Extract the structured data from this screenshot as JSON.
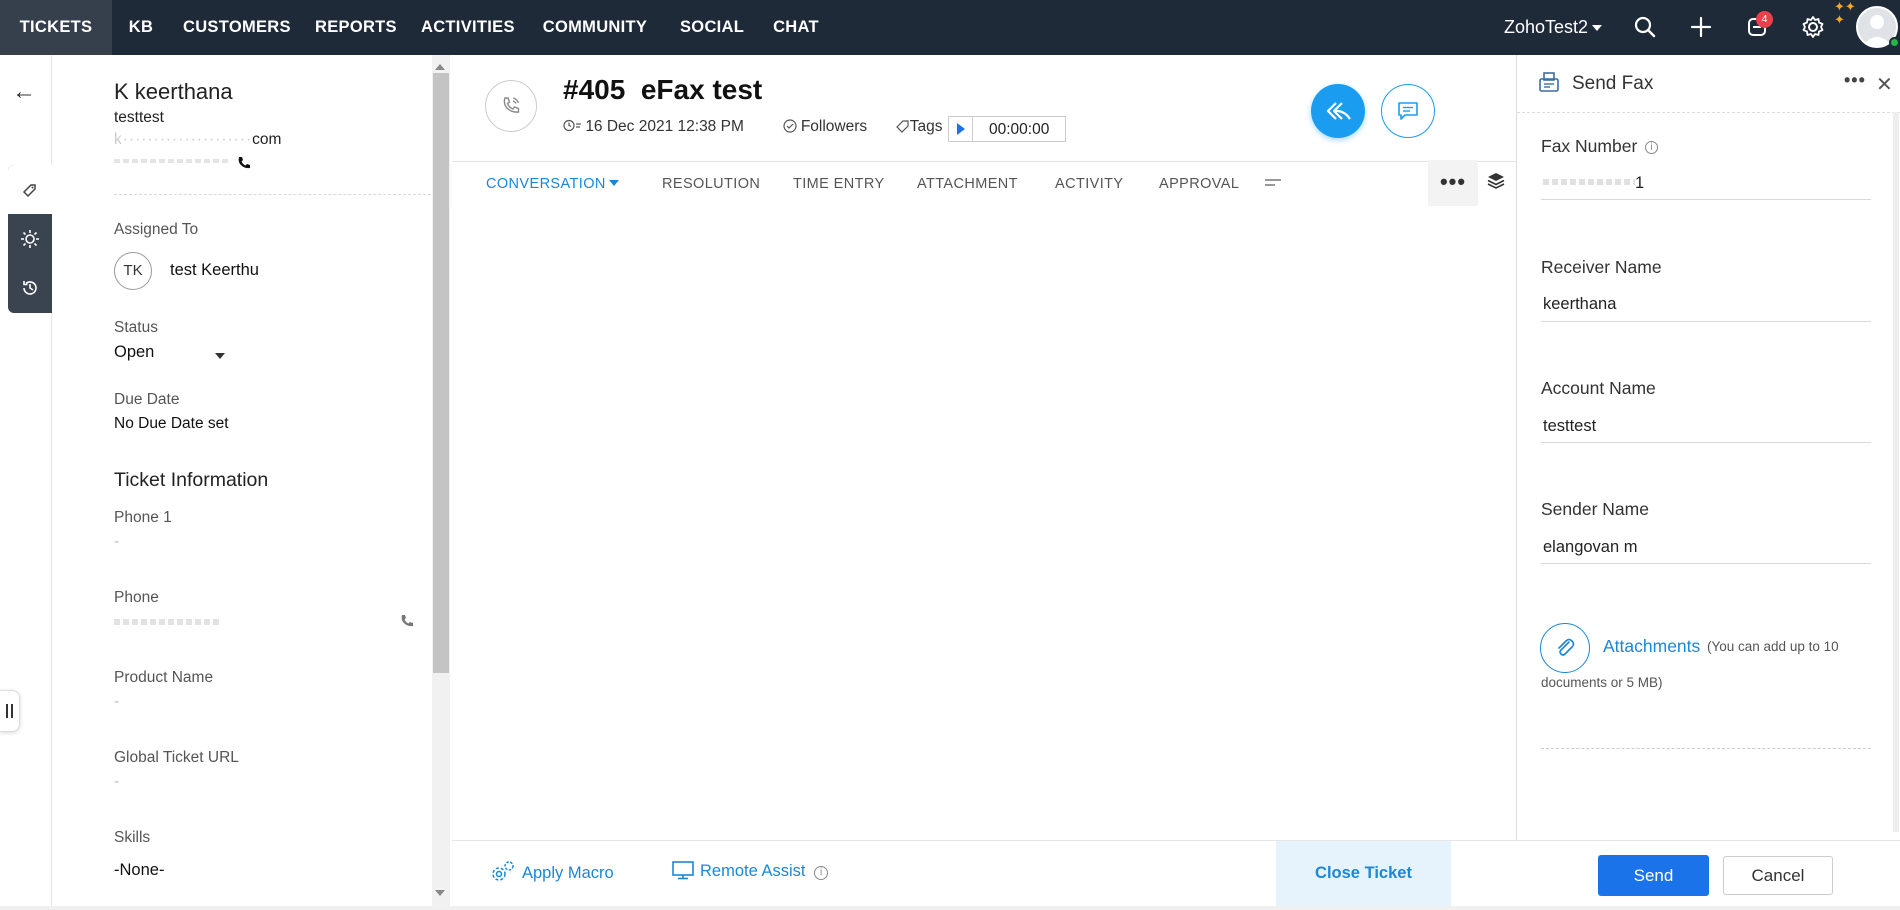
{
  "topnav": {
    "items": [
      "TICKETS",
      "KB",
      "CUSTOMERS",
      "REPORTS",
      "ACTIVITIES",
      "COMMUNITY",
      "SOCIAL",
      "CHAT"
    ],
    "org_name": "ZohoTest2",
    "notification_count": "4"
  },
  "contact": {
    "name": "K keerthana",
    "account": "testtest",
    "email_suffix": "com"
  },
  "properties": {
    "assigned_label": "Assigned To",
    "assignee_initials": "TK",
    "assignee_name": "test Keerthu",
    "status_label": "Status",
    "status_value": "Open",
    "due_label": "Due Date",
    "due_value": "No Due Date set",
    "section_title": "Ticket Information",
    "phone1_label": "Phone 1",
    "phone1_value": "-",
    "phone_label": "Phone",
    "product_label": "Product Name",
    "product_value": "-",
    "global_url_label": "Global Ticket URL",
    "global_url_value": "-",
    "skills_label": "Skills",
    "skills_value": "-None-"
  },
  "ticket": {
    "title": "#405  eFax test",
    "date": "16 Dec 2021 12:38 PM",
    "followers_label": "Followers",
    "tags_label": "Tags",
    "timer": "00:00:00"
  },
  "tabs": [
    "CONVERSATION",
    "RESOLUTION",
    "TIME ENTRY",
    "ATTACHMENT",
    "ACTIVITY",
    "APPROVAL"
  ],
  "footer": {
    "apply_macro": "Apply Macro",
    "remote_assist": "Remote Assist",
    "close_ticket": "Close Ticket"
  },
  "fax": {
    "title": "Send Fax",
    "fax_number_label": "Fax Number",
    "fax_number_value": "1",
    "receiver_label": "Receiver Name",
    "receiver_value": "keerthana",
    "account_label": "Account Name",
    "account_value": "testtest",
    "sender_label": "Sender Name",
    "sender_value": "elangovan m",
    "attachments_label": "Attachments",
    "attach_note_a": "(You can add up to 10",
    "attach_note_b": "documents or 5 MB)",
    "send_label": "Send",
    "cancel_label": "Cancel"
  },
  "colors": {
    "nav_bg": "#1f2a38",
    "accent": "#1a87d8",
    "primary_button": "#1a73e8",
    "badge": "#e8414c"
  }
}
